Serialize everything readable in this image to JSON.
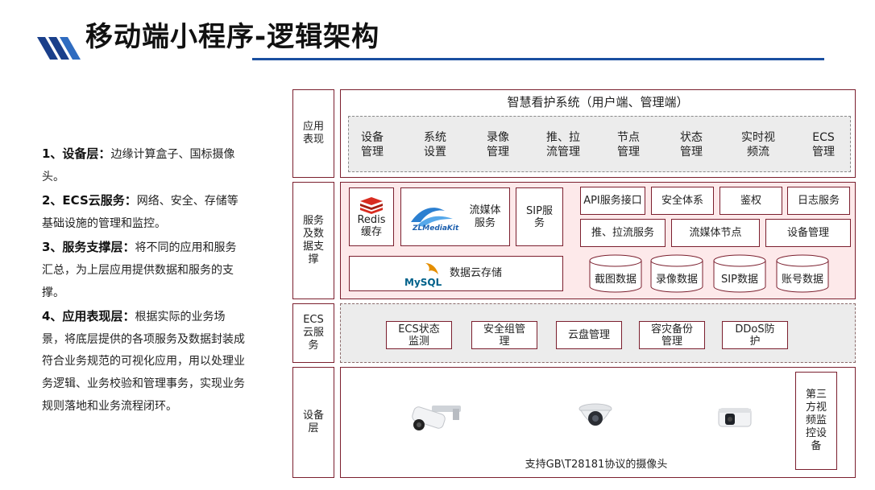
{
  "title": "移动端小程序-逻辑架构",
  "description": [
    {
      "head": "1、设备层：",
      "body": "边缘计算盒子、国标摄像头。"
    },
    {
      "head": "2、ECS云服务：",
      "body": "网络、安全、存储等基础设施的管理和监控。"
    },
    {
      "head": "3、服务支撑层：",
      "body": "将不同的应用和服务汇总，为上层应用提供数据和服务的支撑。"
    },
    {
      "head": "4、应用表现层：",
      "body": "根据实际的业务场景，将底层提供的各项服务及数据封装成符合业务规范的可视化应用，用以处理业务逻辑、业务校验和管理事务，实现业务规则落地和业务流程闭环。"
    }
  ],
  "layers": {
    "app": "应用表现",
    "service": "服务及数据支撑",
    "ecs": "ECS云服务",
    "device": "设备层"
  },
  "app": {
    "system_title": "智慧看护系统（用户端、管理端）",
    "modules": [
      "设备管理",
      "系统设置",
      "录像管理",
      "推、拉流管理",
      "节点管理",
      "状态管理",
      "实时视频流",
      "ECS管理"
    ]
  },
  "service": {
    "redis": "Redis缓存",
    "zlm_logo": "ZLMediaKit",
    "zlm_label": "流媒体服务",
    "sip": "SIP服务",
    "api": "API服务接口",
    "security": "安全体系",
    "auth": "鉴权",
    "log": "日志服务",
    "push_pull": "推、拉流服务",
    "stream_node": "流媒体节点",
    "device_mgmt": "设备管理",
    "mysql_logo": "MySQL",
    "cloud_storage": "数据云存储",
    "data": [
      "截图数据",
      "录像数据",
      "SIP数据",
      "账号数据"
    ]
  },
  "ecs": {
    "items": [
      "ECS状态监测",
      "安全组管理",
      "云盘管理",
      "容灾备份管理",
      "DDoS防护"
    ]
  },
  "device": {
    "third_party": "第三方视频监控设备",
    "camera_caption": "支持GB\\T28181协议的摄像头"
  },
  "colors": {
    "frame": "#7b1f2e",
    "title_line": "#1a4fa0",
    "pink_bg": "#fde9ea",
    "gray_bg": "#ececec"
  }
}
